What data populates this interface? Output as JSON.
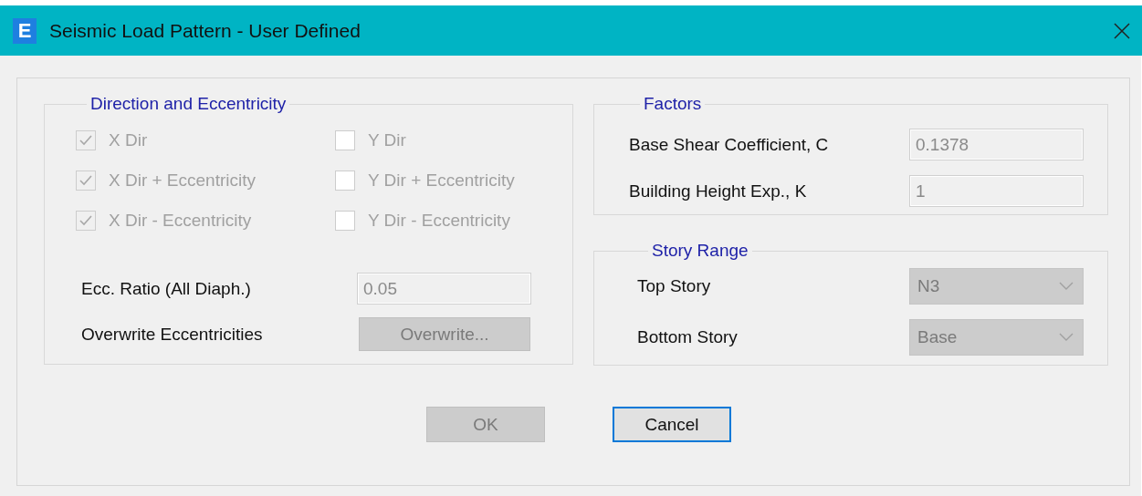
{
  "window": {
    "title": "Seismic Load Pattern - User Defined",
    "app_icon_letter": "E"
  },
  "direction": {
    "title": "Direction and Eccentricity",
    "checkboxes": [
      {
        "label": "X Dir",
        "checked": true,
        "disabled": true
      },
      {
        "label": "Y Dir",
        "checked": false,
        "disabled": true
      },
      {
        "label": "X Dir + Eccentricity",
        "checked": true,
        "disabled": true
      },
      {
        "label": "Y Dir + Eccentricity",
        "checked": false,
        "disabled": true
      },
      {
        "label": "X Dir - Eccentricity",
        "checked": true,
        "disabled": true
      },
      {
        "label": "Y Dir - Eccentricity",
        "checked": false,
        "disabled": true
      }
    ],
    "ecc_ratio": {
      "label": "Ecc. Ratio (All Diaph.)",
      "value": "0.05"
    },
    "overwrite": {
      "label": "Overwrite Eccentricities",
      "button": "Overwrite...",
      "disabled": true
    }
  },
  "factors": {
    "title": "Factors",
    "fields": [
      {
        "label": "Base Shear Coefficient, C",
        "value": "0.1378"
      },
      {
        "label": "Building Height Exp., K",
        "value": "1"
      }
    ]
  },
  "story_range": {
    "title": "Story Range",
    "fields": [
      {
        "label": "Top Story",
        "value": "N3",
        "disabled": true
      },
      {
        "label": "Bottom Story",
        "value": "Base",
        "disabled": true
      }
    ]
  },
  "buttons": [
    {
      "label": "OK",
      "disabled": true,
      "focused": false
    },
    {
      "label": "Cancel",
      "disabled": false,
      "focused": true
    }
  ]
}
